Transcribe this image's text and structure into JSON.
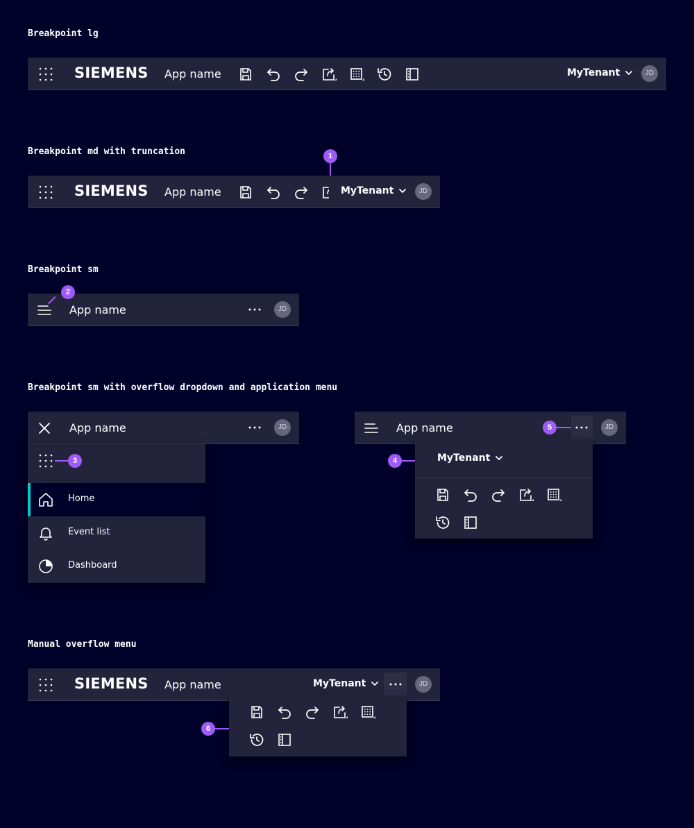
{
  "sections": {
    "lg_title": "Breakpoint lg",
    "md_title": "Breakpoint md with truncation",
    "sm_title": "Breakpoint sm",
    "sm_overflow_title": "Breakpoint sm with overflow dropdown and application menu",
    "manual_title": "Manual overflow menu"
  },
  "header": {
    "logo": "SIEMENS",
    "app_name": "App name",
    "tenant": "MyTenant",
    "avatar_initials": "JD"
  },
  "nav_menu": {
    "items": [
      {
        "label": "Home",
        "icon": "home-icon",
        "active": true
      },
      {
        "label": "Event list",
        "icon": "bell-icon"
      },
      {
        "label": "Dashboard",
        "icon": "pie-chart-icon"
      }
    ]
  },
  "callouts": [
    "1",
    "2",
    "3",
    "4",
    "5",
    "6"
  ],
  "colors": {
    "page_bg": "#000028",
    "bar_bg": "#23233c",
    "accent_active": "#00cccc",
    "callout": "#9f5bf7",
    "avatar_bg": "#66667e"
  },
  "toolbar_icons": [
    "save-icon",
    "undo-icon",
    "redo-icon",
    "export-icon",
    "grid-icon",
    "history-icon",
    "panel-icon"
  ]
}
